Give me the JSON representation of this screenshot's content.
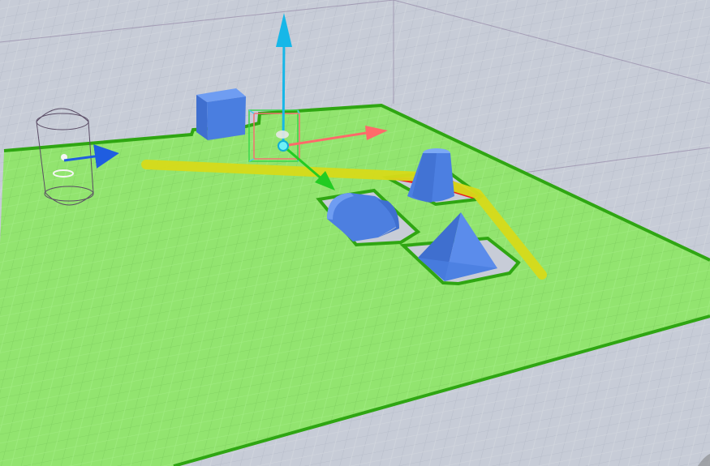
{
  "scene": {
    "label": "",
    "colors": {
      "floor": "#c6cbd6",
      "navmesh_fill": "#8ee867",
      "navmesh_edge": "#36a60f",
      "object_blue": "#4b7fe0",
      "gizmo_x": "#ff6a6a",
      "gizmo_y": "#22cc22",
      "gizmo_z": "#19b7e6",
      "path_yellow": "#d7da19",
      "blocked_red": "#e31414"
    },
    "objects": [
      {
        "name": "cube",
        "icon": "cube-icon"
      },
      {
        "name": "cone",
        "icon": "cone-icon"
      },
      {
        "name": "half-cylinder",
        "icon": "half-cylinder-icon"
      },
      {
        "name": "pyramid",
        "icon": "pyramid-icon"
      },
      {
        "name": "character-capsule",
        "icon": "capsule-icon"
      }
    ],
    "gizmo": {
      "axes": [
        "x-axis",
        "y-axis",
        "z-axis"
      ],
      "mode": "translate"
    }
  }
}
